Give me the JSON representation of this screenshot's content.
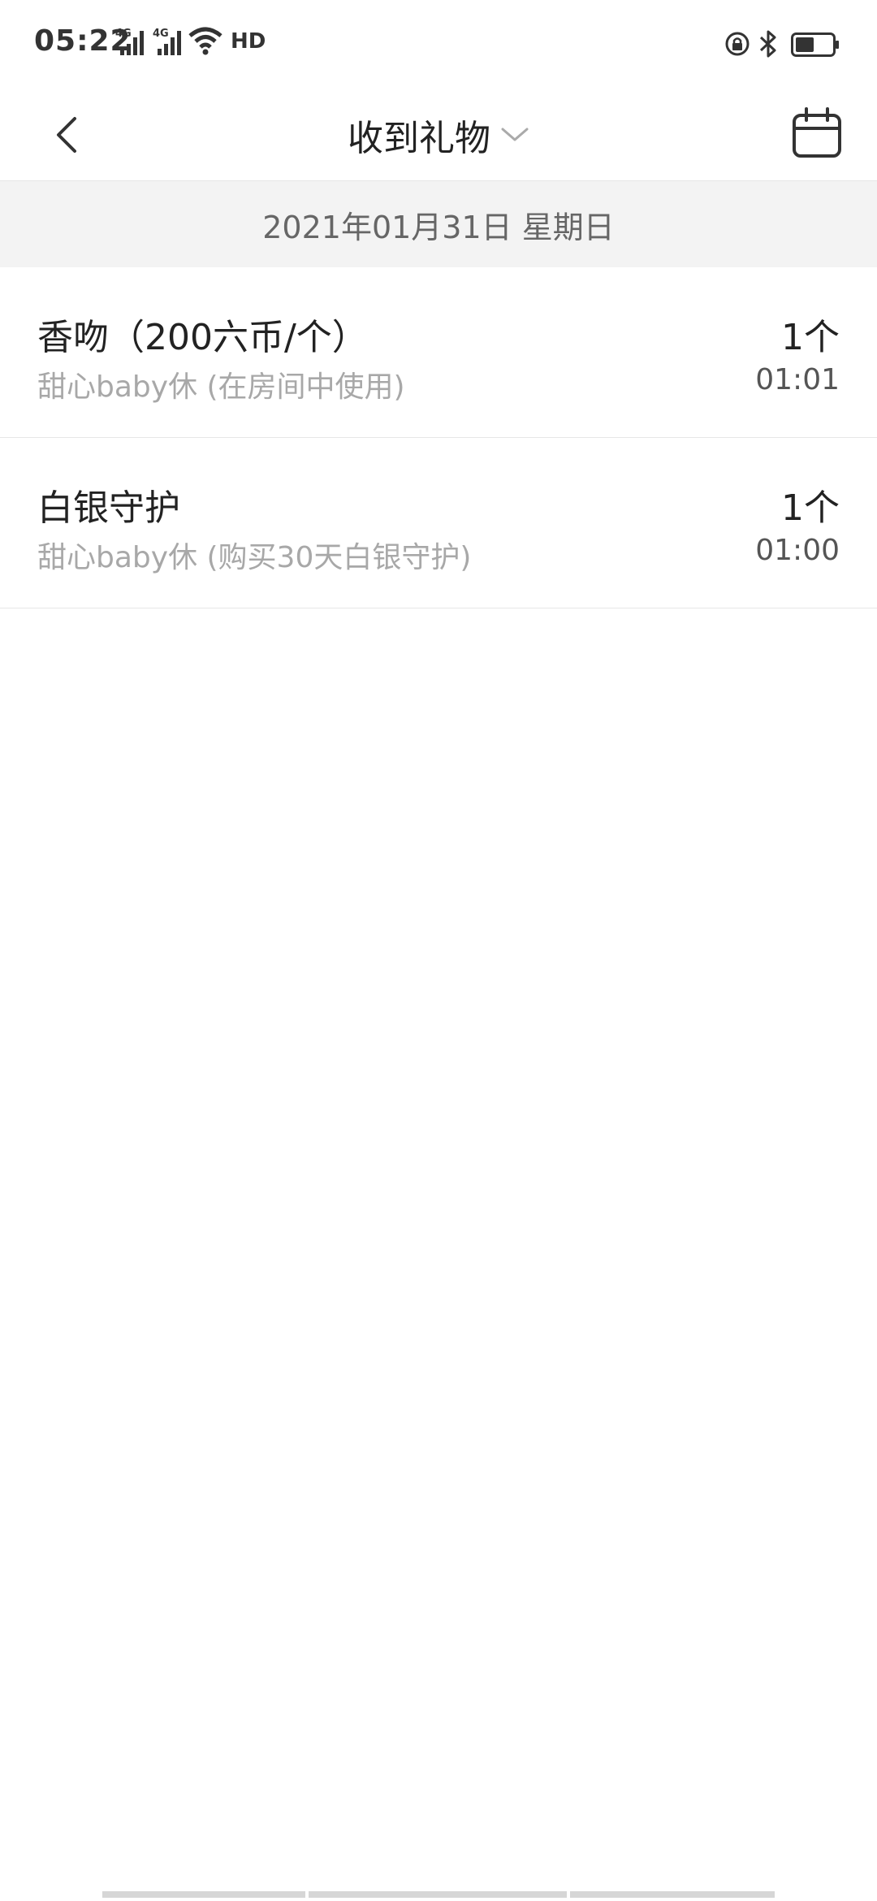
{
  "status_bar": {
    "time": "05:22",
    "signal1_label": "4G",
    "signal2_label": "4G",
    "hd_label": "HD",
    "icons": [
      "signal-icon",
      "signal-icon",
      "wifi-icon",
      "hd-icon",
      "rotation-lock-icon",
      "bluetooth-icon",
      "battery-icon"
    ]
  },
  "nav": {
    "title": "收到礼物",
    "back_icon": "chevron-left-icon",
    "dropdown_icon": "chevron-down-icon",
    "calendar_icon": "calendar-icon"
  },
  "date_header": "2021年01月31日 星期日",
  "gifts": [
    {
      "name": "香吻（200六币/个）",
      "detail": "甜心baby休 (在房间中使用)",
      "count": "1个",
      "time": "01:01"
    },
    {
      "name": "白银守护",
      "detail": "甜心baby休 (购买30天白银守护)",
      "count": "1个",
      "time": "01:00"
    }
  ]
}
